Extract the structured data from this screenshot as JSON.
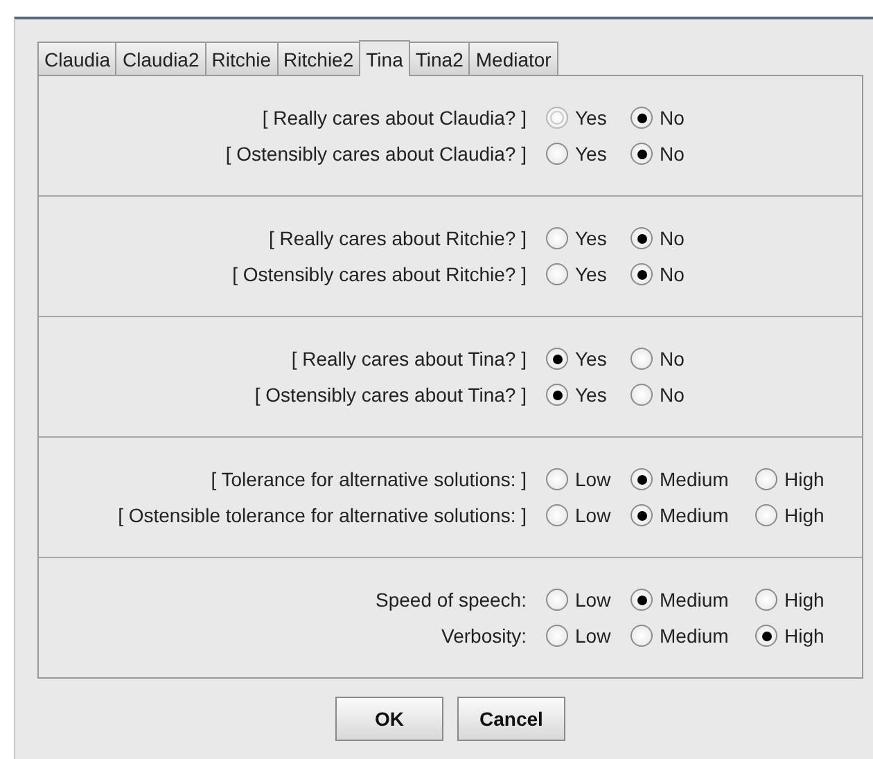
{
  "tabs": [
    {
      "label": "Claudia",
      "selected": false
    },
    {
      "label": "Claudia2",
      "selected": false
    },
    {
      "label": "Ritchie",
      "selected": false
    },
    {
      "label": "Ritchie2",
      "selected": false
    },
    {
      "label": "Tina",
      "selected": true
    },
    {
      "label": "Tina2",
      "selected": false
    },
    {
      "label": "Mediator",
      "selected": false
    }
  ],
  "sections": [
    {
      "rows": [
        {
          "label": "[ Really cares about Claudia? ]",
          "options": [
            {
              "label": "Yes",
              "selected": false,
              "disabled": true
            },
            {
              "label": "No",
              "selected": true,
              "disabled": false
            }
          ]
        },
        {
          "label": "[ Ostensibly cares about Claudia? ]",
          "options": [
            {
              "label": "Yes",
              "selected": false,
              "disabled": false
            },
            {
              "label": "No",
              "selected": true,
              "disabled": false
            }
          ]
        }
      ]
    },
    {
      "rows": [
        {
          "label": "[ Really cares about Ritchie? ]",
          "options": [
            {
              "label": "Yes",
              "selected": false,
              "disabled": false
            },
            {
              "label": "No",
              "selected": true,
              "disabled": false
            }
          ]
        },
        {
          "label": "[ Ostensibly cares about Ritchie? ]",
          "options": [
            {
              "label": "Yes",
              "selected": false,
              "disabled": false
            },
            {
              "label": "No",
              "selected": true,
              "disabled": false
            }
          ]
        }
      ]
    },
    {
      "rows": [
        {
          "label": "[ Really cares about Tina? ]",
          "options": [
            {
              "label": "Yes",
              "selected": true,
              "disabled": false
            },
            {
              "label": "No",
              "selected": false,
              "disabled": false
            }
          ]
        },
        {
          "label": "[ Ostensibly cares about Tina? ]",
          "options": [
            {
              "label": "Yes",
              "selected": true,
              "disabled": false
            },
            {
              "label": "No",
              "selected": false,
              "disabled": false
            }
          ]
        }
      ]
    },
    {
      "rows": [
        {
          "label": "[ Tolerance for alternative solutions: ]",
          "options": [
            {
              "label": "Low",
              "selected": false,
              "disabled": false
            },
            {
              "label": "Medium",
              "selected": true,
              "disabled": false
            },
            {
              "label": "High",
              "selected": false,
              "disabled": false
            }
          ]
        },
        {
          "label": "[ Ostensible tolerance for alternative solutions: ]",
          "options": [
            {
              "label": "Low",
              "selected": false,
              "disabled": false
            },
            {
              "label": "Medium",
              "selected": true,
              "disabled": false
            },
            {
              "label": "High",
              "selected": false,
              "disabled": false
            }
          ]
        }
      ]
    },
    {
      "rows": [
        {
          "label": "Speed of speech:",
          "options": [
            {
              "label": "Low",
              "selected": false,
              "disabled": false
            },
            {
              "label": "Medium",
              "selected": true,
              "disabled": false
            },
            {
              "label": "High",
              "selected": false,
              "disabled": false
            }
          ]
        },
        {
          "label": "Verbosity:",
          "options": [
            {
              "label": "Low",
              "selected": false,
              "disabled": false
            },
            {
              "label": "Medium",
              "selected": false,
              "disabled": false
            },
            {
              "label": "High",
              "selected": true,
              "disabled": false
            }
          ]
        }
      ]
    }
  ],
  "buttons": [
    "OK",
    "Cancel"
  ]
}
